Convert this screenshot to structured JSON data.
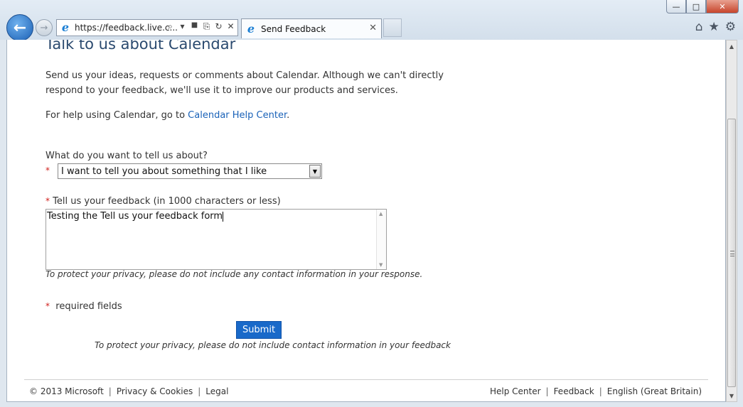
{
  "browser": {
    "address_url": "https://feedback.live.c...",
    "tab_title": "Send Feedback",
    "window_controls": {
      "minimize": "—",
      "maximize": "□",
      "close": "✕"
    },
    "nav_back_icon": "←",
    "nav_forward_icon": "→",
    "address_icons": {
      "search": "⌕",
      "dropdown": "▾",
      "lock": "🔒",
      "compat": "⎘",
      "refresh": "↻",
      "stop": "✕"
    },
    "tool_icons": {
      "home": "⌂",
      "favorites": "★",
      "tools": "⚙"
    }
  },
  "page": {
    "title": "Talk to us about Calendar",
    "intro": "Send us your ideas, requests or comments about Calendar. Although we can't directly respond to your feedback, we'll use it to improve our products and services.",
    "help_prefix": "For help using Calendar, go to ",
    "help_link": "Calendar Help Center",
    "help_suffix": ".",
    "topic_label": "What do you want to tell us about?",
    "topic_value": "I want to tell you about something that I like",
    "feedback_label": "Tell us your feedback (in 1000 characters or less)",
    "feedback_value": "Testing the Tell us your feedback form",
    "privacy_note": "To protect your privacy, please do not include any contact information in your response.",
    "required_note": "required fields",
    "required_star": "*",
    "submit_label": "Submit",
    "privacy_note_2": "To protect your privacy, please do not include contact information in your feedback"
  },
  "footer": {
    "copyright": "© 2013 Microsoft",
    "privacy": "Privacy & Cookies",
    "legal": "Legal",
    "help_center": "Help Center",
    "feedback": "Feedback",
    "language": "English (Great Britain)",
    "separator": "|"
  },
  "colors": {
    "link": "#1a62b8",
    "submit_bg": "#1969c9",
    "title": "#2b4a6f",
    "required": "#d0201c"
  }
}
